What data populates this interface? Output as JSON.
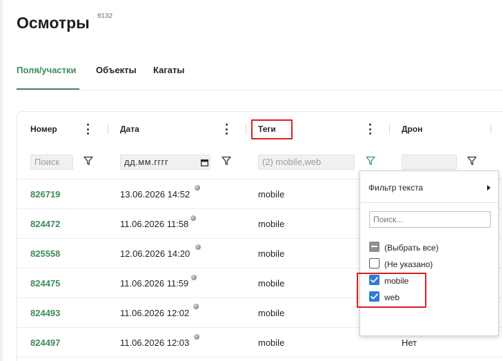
{
  "page": {
    "title": "Осмотры",
    "count": "9132"
  },
  "tabs": [
    {
      "label": "Поля/участки",
      "active": true
    },
    {
      "label": "Объекты",
      "active": false
    },
    {
      "label": "Кагаты",
      "active": false
    }
  ],
  "grid": {
    "columns": [
      {
        "label": "Номер"
      },
      {
        "label": "Дата"
      },
      {
        "label": "Теги"
      },
      {
        "label": "Дрон"
      }
    ],
    "filters": {
      "number_placeholder": "Поиск",
      "date_placeholder": "дд.мм.гггг",
      "tags_value": "(2) mobile,web",
      "drone_value": ""
    },
    "rows": [
      {
        "number": "826719",
        "date": "13.06.2026 14:52",
        "tag": "mobile",
        "drone": ""
      },
      {
        "number": "824472",
        "date": "11.06.2026 11:58",
        "tag": "mobile",
        "drone": ""
      },
      {
        "number": "825558",
        "date": "12.06.2026 14:20",
        "tag": "mobile",
        "drone": ""
      },
      {
        "number": "824475",
        "date": "11.06.2026 11:59",
        "tag": "mobile",
        "drone": ""
      },
      {
        "number": "824493",
        "date": "11.06.2026 12:02",
        "tag": "mobile",
        "drone": ""
      },
      {
        "number": "824497",
        "date": "11.06.2026 12:03",
        "tag": "mobile",
        "drone": "Нет"
      }
    ]
  },
  "filter_popup": {
    "menu_label": "Фильтр текста",
    "search_placeholder": "Поиск...",
    "options": [
      {
        "label": "(Выбрать все)",
        "state": "indeterminate"
      },
      {
        "label": "(Не указано)",
        "state": "unchecked"
      },
      {
        "label": "mobile",
        "state": "checked"
      },
      {
        "label": "web",
        "state": "checked"
      }
    ]
  },
  "colors": {
    "accent_green": "#3a8a5c",
    "highlight_red": "#d81e1e",
    "checkbox_blue": "#2e7bd6",
    "active_filter_green": "#3a9a62"
  }
}
